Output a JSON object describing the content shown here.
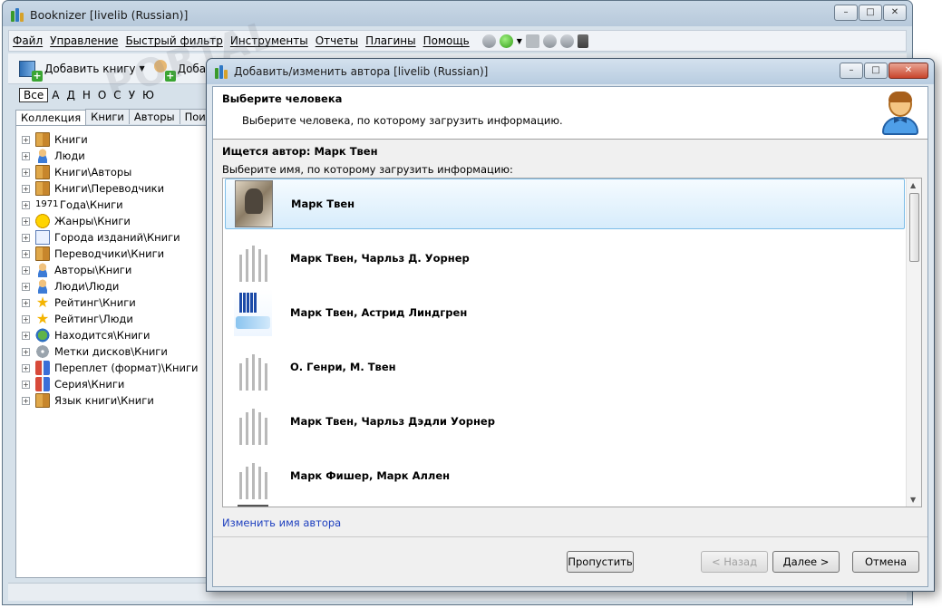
{
  "main_window": {
    "title": "Booknizer [livelib (Russian)]",
    "menu": [
      "Файл",
      "Управление",
      "Быстрый фильтр",
      "Инструменты",
      "Отчеты",
      "Плагины",
      "Помощь"
    ],
    "toolbar": {
      "add_book": "Добавить книгу",
      "add_person": "Добави"
    },
    "alphabet": [
      "Все",
      "А",
      "Д",
      "Н",
      "О",
      "С",
      "У",
      "Ю"
    ],
    "tabs": [
      "Коллекция",
      "Книги",
      "Авторы",
      "Поиск"
    ],
    "watermark": "PORTAL",
    "tree": [
      {
        "label": "Книги",
        "icon": "book-icon"
      },
      {
        "label": "Люди",
        "icon": "people-icon"
      },
      {
        "label": "Книги\\Авторы",
        "icon": "book-icon"
      },
      {
        "label": "Книги\\Переводчики",
        "icon": "book-icon"
      },
      {
        "label": "Года\\Книги",
        "icon": "year-icon",
        "prefix": "1971"
      },
      {
        "label": "Жанры\\Книги",
        "icon": "smile-icon"
      },
      {
        "label": "Города изданий\\Книги",
        "icon": "document-icon"
      },
      {
        "label": "Переводчики\\Книги",
        "icon": "book-icon"
      },
      {
        "label": "Авторы\\Книги",
        "icon": "people-icon"
      },
      {
        "label": "Люди\\Люди",
        "icon": "people-icon"
      },
      {
        "label": "Рейтинг\\Книги",
        "icon": "star-icon"
      },
      {
        "label": "Рейтинг\\Люди",
        "icon": "star-icon"
      },
      {
        "label": "Находится\\Книги",
        "icon": "globe-icon"
      },
      {
        "label": "Метки дисков\\Книги",
        "icon": "disk-icon"
      },
      {
        "label": "Переплет (формат)\\Книги",
        "icon": "open-book-icon"
      },
      {
        "label": "Серия\\Книги",
        "icon": "open-book-icon"
      },
      {
        "label": "Язык книги\\Книги",
        "icon": "book-icon"
      }
    ]
  },
  "dialog": {
    "title": "Добавить/изменить автора [livelib (Russian)]",
    "header_title": "Выберите человека",
    "header_subtitle": "Выберите человека, по которому загрузить информацию.",
    "searching_label": "Ищется автор: Марк Твен",
    "choose_label": "Выберите имя, по которому загрузить информацию:",
    "results": [
      {
        "name": "Марк Твен",
        "thumb": "photo",
        "selected": true
      },
      {
        "name": "Марк Твен, Чарльз Д. Уорнер",
        "thumb": "placeholder"
      },
      {
        "name": "Марк Твен, Астрид Линдгрен",
        "thumb": "logo"
      },
      {
        "name": "О. Генри, М. Твен",
        "thumb": "placeholder"
      },
      {
        "name": "Марк Твен, Чарльз Дэдли Уорнер",
        "thumb": "placeholder"
      },
      {
        "name": "Марк Фишер, Марк Аллен",
        "thumb": "placeholder"
      }
    ],
    "rename_link": "Изменить имя автора",
    "buttons": {
      "skip": "Пропустить",
      "back": "< Назад",
      "next": "Далее >",
      "cancel": "Отмена"
    }
  }
}
